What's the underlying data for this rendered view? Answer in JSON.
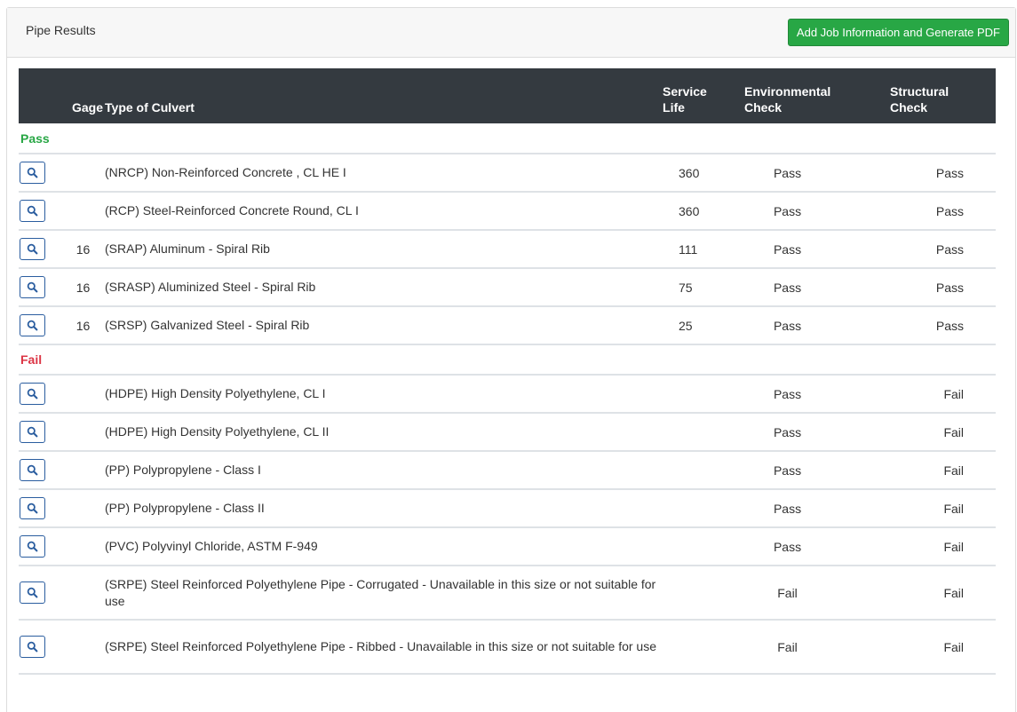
{
  "header": {
    "title": "Pipe Results",
    "pdf_button_label": "Add Job Information and Generate PDF",
    "pdf_button_color": "#28a745"
  },
  "table": {
    "columns": {
      "view": "",
      "gage": "Gage",
      "type": "Type of Culvert",
      "service_life": "Service Life",
      "environmental": "Environmental Check",
      "structural": "Structural Check"
    },
    "groups": [
      {
        "label": "Pass",
        "color": "#28a745",
        "rows": [
          {
            "icon": "magnifier-icon",
            "gage": "",
            "type": "(NRCP) Non-Reinforced Concrete , CL HE I",
            "service_life": "360",
            "environmental": "Pass",
            "structural": "Pass"
          },
          {
            "icon": "magnifier-icon",
            "gage": "",
            "type": "(RCP) Steel-Reinforced Concrete Round, CL I",
            "service_life": "360",
            "environmental": "Pass",
            "structural": "Pass"
          },
          {
            "icon": "magnifier-icon",
            "gage": "16",
            "type": "(SRAP) Aluminum - Spiral Rib",
            "service_life": "111",
            "environmental": "Pass",
            "structural": "Pass"
          },
          {
            "icon": "magnifier-icon",
            "gage": "16",
            "type": "(SRASP) Aluminized Steel - Spiral Rib",
            "service_life": "75",
            "environmental": "Pass",
            "structural": "Pass"
          },
          {
            "icon": "magnifier-icon",
            "gage": "16",
            "type": "(SRSP) Galvanized Steel - Spiral Rib",
            "service_life": "25",
            "environmental": "Pass",
            "structural": "Pass"
          }
        ]
      },
      {
        "label": "Fail",
        "color": "#dc3545",
        "rows": [
          {
            "icon": "magnifier-icon",
            "gage": "",
            "type": "(HDPE) High Density Polyethylene, CL I",
            "service_life": "",
            "environmental": "Pass",
            "structural": "Fail"
          },
          {
            "icon": "magnifier-icon",
            "gage": "",
            "type": "(HDPE) High Density Polyethylene, CL II",
            "service_life": "",
            "environmental": "Pass",
            "structural": "Fail"
          },
          {
            "icon": "magnifier-icon",
            "gage": "",
            "type": "(PP) Polypropylene - Class I",
            "service_life": "",
            "environmental": "Pass",
            "structural": "Fail"
          },
          {
            "icon": "magnifier-icon",
            "gage": "",
            "type": "(PP) Polypropylene - Class II",
            "service_life": "",
            "environmental": "Pass",
            "structural": "Fail"
          },
          {
            "icon": "magnifier-icon",
            "gage": "",
            "type": "(PVC) Polyvinyl Chloride, ASTM F-949",
            "service_life": "",
            "environmental": "Pass",
            "structural": "Fail"
          },
          {
            "icon": "magnifier-icon",
            "gage": "",
            "type": "(SRPE) Steel Reinforced Polyethylene Pipe - Corrugated - Unavailable in this size or not suitable for use",
            "service_life": "",
            "environmental": "Fail",
            "structural": "Fail"
          },
          {
            "icon": "magnifier-icon",
            "gage": "",
            "type": "(SRPE) Steel Reinforced Polyethylene Pipe - Ribbed - Unavailable in this size or not suitable for use",
            "service_life": "",
            "environmental": "Fail",
            "structural": "Fail"
          }
        ]
      }
    ]
  }
}
